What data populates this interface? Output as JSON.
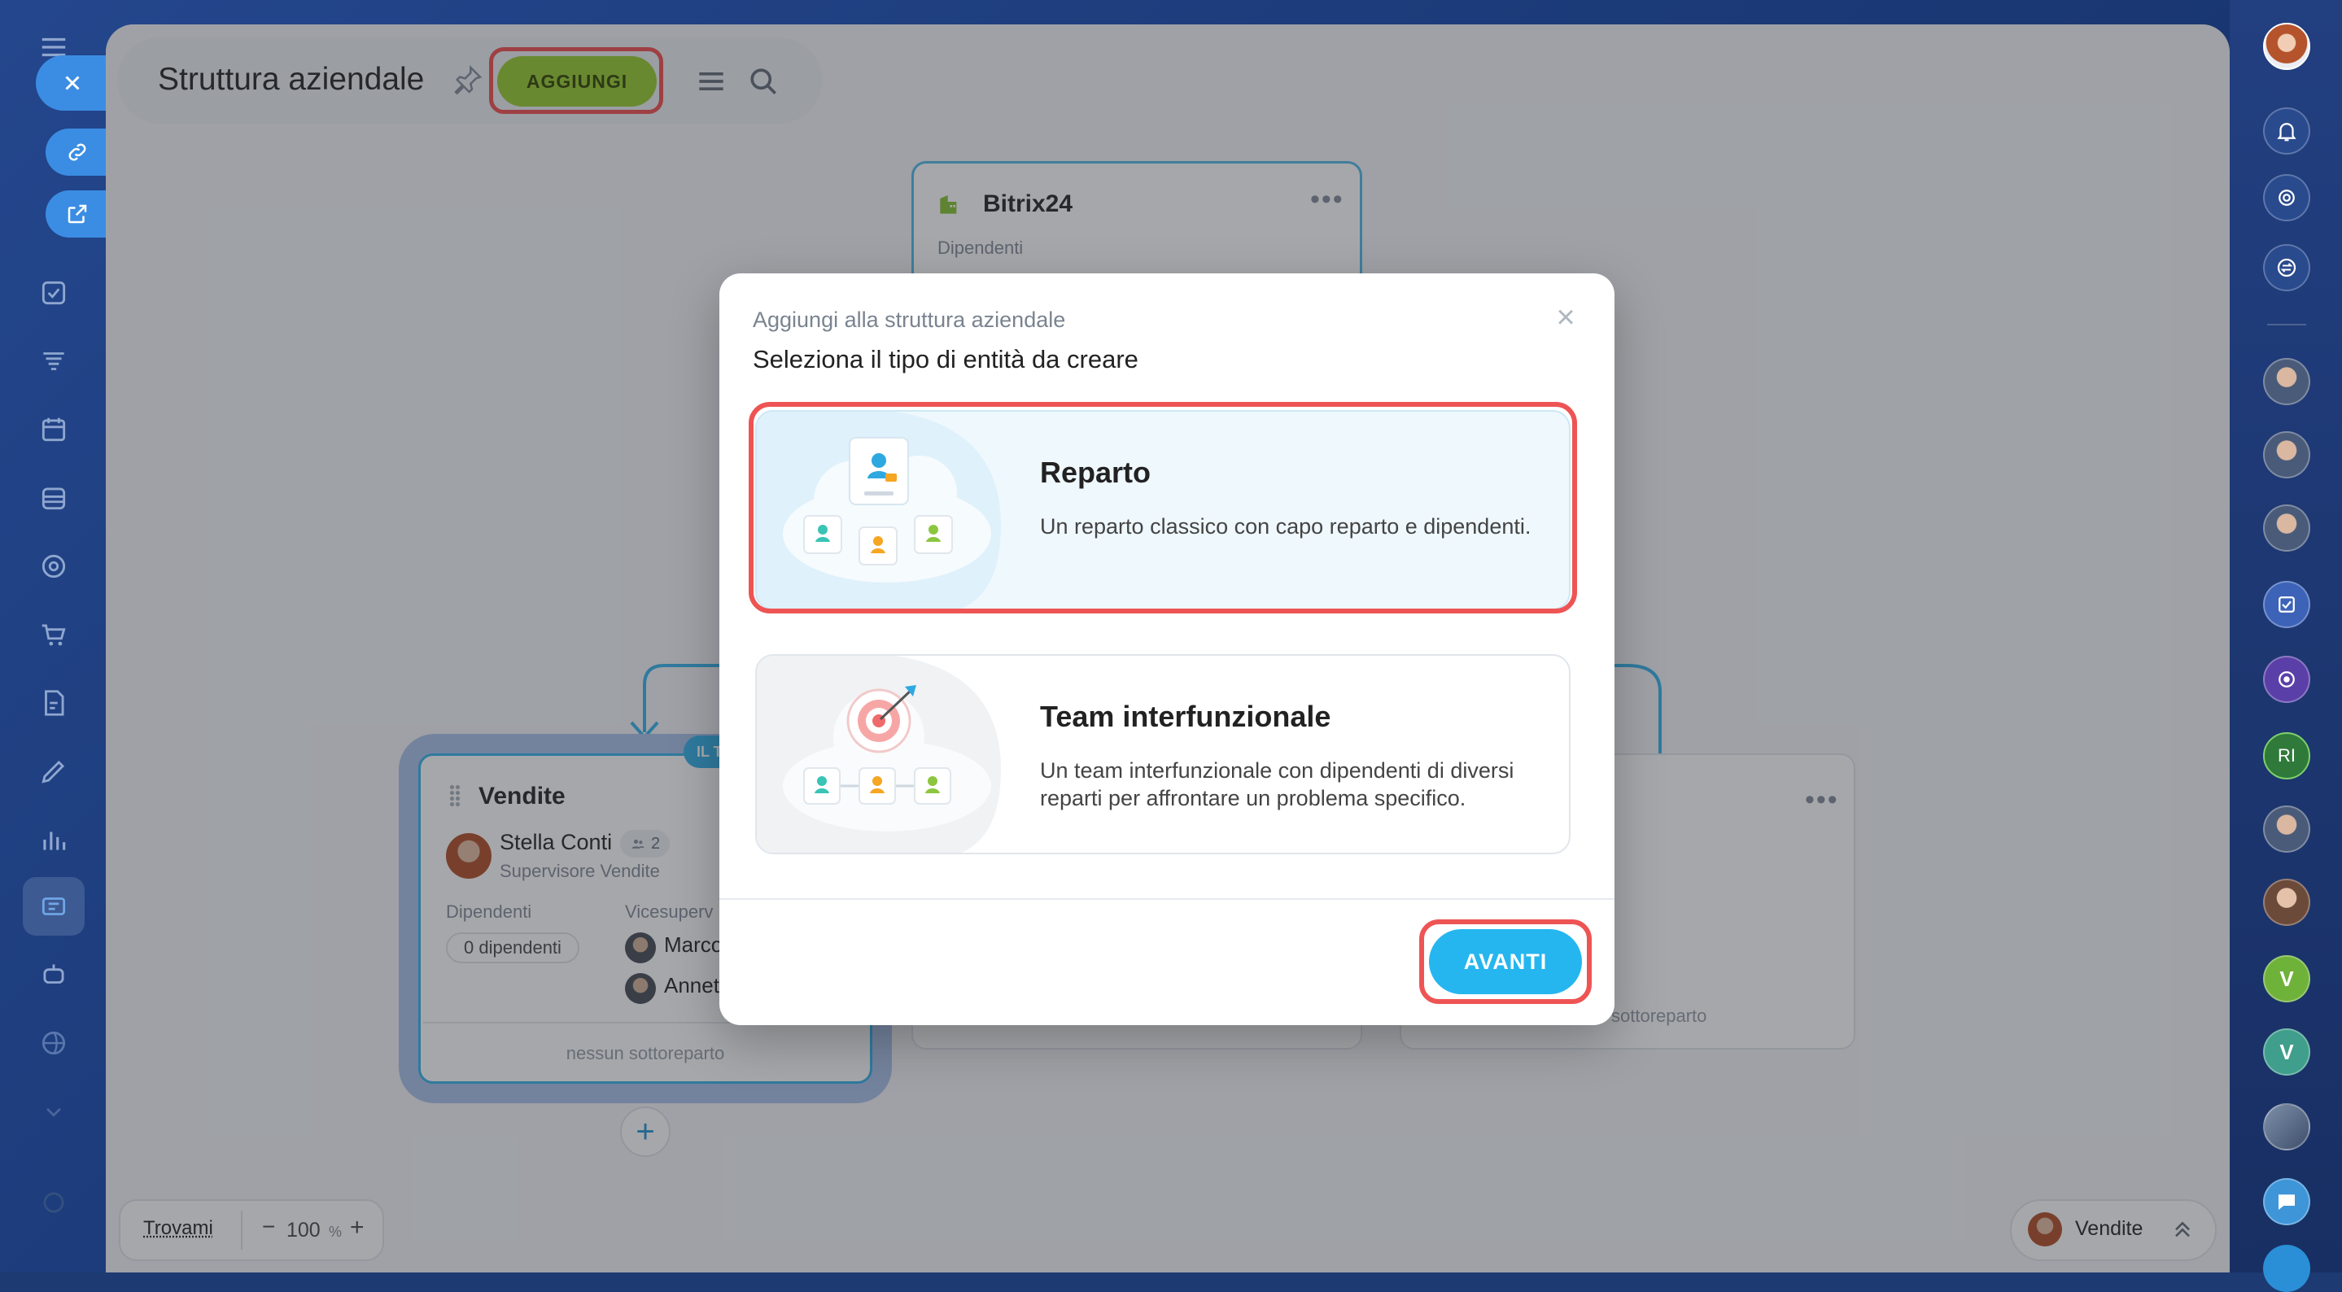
{
  "toolbar": {
    "title": "Struttura aziendale",
    "add_label": "AGGIUNGI"
  },
  "org": {
    "root": {
      "name": "Bitrix24",
      "employees_label": "Dipendenti"
    },
    "vendite": {
      "name": "Vendite",
      "badge": "IL T",
      "head_name": "Stella Conti",
      "head_count": "2",
      "head_role": "Supervisore Vendite",
      "employees_label": "Dipendenti",
      "employees_value": "0 dipendenti",
      "deputies_label": "Vicesuperv",
      "deputy_1": "Marco",
      "deputy_2": "Annet",
      "subdept": "nessun sottoreparto"
    },
    "right_card_subdept": "sottoreparto"
  },
  "bottom": {
    "find": "Trovami",
    "zoom_minus": "−",
    "zoom_value": "100",
    "zoom_unit": "%",
    "zoom_plus": "+",
    "dept_label": "Vendite"
  },
  "modal": {
    "subtitle": "Aggiungi alla struttura aziendale",
    "heading": "Seleziona il tipo di entità da creare",
    "options": [
      {
        "title": "Reparto",
        "description": "Un reparto classico con capo reparto e dipendenti."
      },
      {
        "title": "Team interfunzionale",
        "description": "Un team interfunzionale con dipendenti di diversi reparti per affrontare un problema specifico."
      }
    ],
    "next_label": "AVANTI"
  },
  "right_sidebar": {
    "letters": [
      "RI",
      "V",
      "V"
    ]
  },
  "colors": {
    "accent_blue": "#25b6f0",
    "add_green": "#9dcf3a",
    "highlight_red": "#ee5454",
    "sidebar_bg": "#1b3a78"
  }
}
